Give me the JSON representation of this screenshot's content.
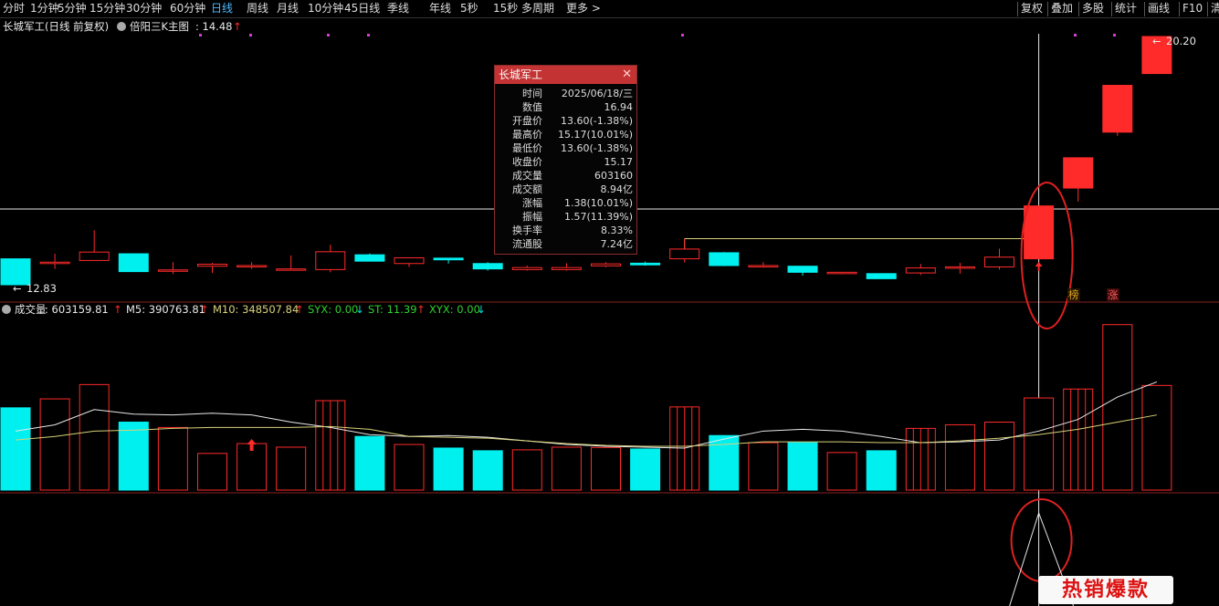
{
  "toolbar": {
    "periods": [
      "分时",
      "1分钟",
      "5分钟",
      "15分钟",
      "30分钟",
      "60分钟",
      "日线",
      "周线",
      "月线",
      "10分钟",
      "45日线",
      "季线",
      "年线",
      "5秒",
      "15秒",
      "多周期",
      "更多 >"
    ],
    "active_period": "日线",
    "right_buttons": [
      "复权",
      "叠加",
      "多股",
      "统计",
      "画线",
      "F10",
      "清"
    ]
  },
  "main_panel": {
    "title": "长城军工(日线 前复权)",
    "indicator": "倍阳三K主图",
    "indicator_value": ": 14.48",
    "high_label": "20.20",
    "low_label": "12.83",
    "tags": [
      "榜",
      "涨"
    ]
  },
  "volume_panel": {
    "label": "成交量",
    "value": ": 603159.81",
    "ma5": "M5: 390763.81",
    "ma10": "M10: 348507.84",
    "syx": "SYX: 0.00",
    "st": "ST: 11.39",
    "xyx": "XYX: 0.00"
  },
  "tooltip": {
    "title": "长城军工",
    "rows": [
      {
        "key": "时间",
        "value": "2025/06/18/三",
        "color": "white"
      },
      {
        "key": "数值",
        "value": "16.94",
        "color": "white"
      },
      {
        "key": "开盘价",
        "value": "13.60(-1.38%)",
        "color": "green"
      },
      {
        "key": "最高价",
        "value": "15.17(10.01%)",
        "color": "red"
      },
      {
        "key": "最低价",
        "value": "13.60(-1.38%)",
        "color": "green"
      },
      {
        "key": "收盘价",
        "value": "15.17",
        "color": "red"
      },
      {
        "key": "成交量",
        "value": "603160",
        "color": "yellow"
      },
      {
        "key": "成交额",
        "value": "8.94亿",
        "color": "white"
      },
      {
        "key": "涨幅",
        "value": "1.38(10.01%)",
        "color": "red"
      },
      {
        "key": "振幅",
        "value": "1.57(11.39%)",
        "color": "white"
      },
      {
        "key": "换手率",
        "value": "8.33%",
        "color": "white"
      },
      {
        "key": "流通股",
        "value": "7.24亿",
        "color": "white"
      }
    ]
  },
  "badge": "热销爆款",
  "colors": {
    "up": "#ff2a2a",
    "down": "#00f0f0",
    "ma5": "#e8e8e8",
    "ma10": "#d8d27a",
    "active": "#4fb8ff",
    "annot": "#e02020"
  },
  "chart_data": {
    "type": "candlestick",
    "candles": [
      {
        "o": 13.6,
        "c": 12.83,
        "h": 13.6,
        "l": 12.83
      },
      {
        "o": 13.5,
        "c": 13.5,
        "h": 13.75,
        "l": 13.3
      },
      {
        "o": 13.55,
        "c": 13.8,
        "h": 14.45,
        "l": 13.55
      },
      {
        "o": 13.75,
        "c": 13.22,
        "h": 13.75,
        "l": 13.22
      },
      {
        "o": 13.23,
        "c": 13.27,
        "h": 13.5,
        "l": 13.15
      },
      {
        "o": 13.38,
        "c": 13.44,
        "h": 13.48,
        "l": 13.18
      },
      {
        "o": 13.4,
        "c": 13.4,
        "h": 13.5,
        "l": 13.3
      },
      {
        "o": 13.26,
        "c": 13.3,
        "h": 13.7,
        "l": 13.26
      },
      {
        "o": 13.28,
        "c": 13.81,
        "h": 14.02,
        "l": 13.2
      },
      {
        "o": 13.72,
        "c": 13.53,
        "h": 13.76,
        "l": 13.53
      },
      {
        "o": 13.46,
        "c": 13.63,
        "h": 13.63,
        "l": 13.36
      },
      {
        "o": 13.62,
        "c": 13.57,
        "h": 13.62,
        "l": 13.46
      },
      {
        "o": 13.46,
        "c": 13.3,
        "h": 13.5,
        "l": 13.25
      },
      {
        "o": 13.28,
        "c": 13.34,
        "h": 13.4,
        "l": 13.25
      },
      {
        "o": 13.28,
        "c": 13.34,
        "h": 13.47,
        "l": 13.25
      },
      {
        "o": 13.39,
        "c": 13.45,
        "h": 13.5,
        "l": 13.35
      },
      {
        "o": 13.47,
        "c": 13.42,
        "h": 13.52,
        "l": 13.39
      },
      {
        "o": 13.6,
        "c": 13.89,
        "h": 14.2,
        "l": 13.49
      },
      {
        "o": 13.78,
        "c": 13.4,
        "h": 13.8,
        "l": 13.38
      },
      {
        "o": 13.36,
        "c": 13.4,
        "h": 13.5,
        "l": 13.34
      },
      {
        "o": 13.38,
        "c": 13.2,
        "h": 13.38,
        "l": 13.1
      },
      {
        "o": 13.2,
        "c": 13.2,
        "h": 13.2,
        "l": 13.14
      },
      {
        "o": 13.16,
        "c": 13.01,
        "h": 13.16,
        "l": 13.01
      },
      {
        "o": 13.18,
        "c": 13.33,
        "h": 13.45,
        "l": 13.12
      },
      {
        "o": 13.36,
        "c": 13.36,
        "h": 13.48,
        "l": 13.16
      },
      {
        "o": 13.36,
        "c": 13.65,
        "h": 13.9,
        "l": 13.28
      },
      {
        "o": 13.6,
        "c": 15.17,
        "h": 15.17,
        "l": 13.6
      },
      {
        "o": 15.7,
        "c": 16.6,
        "h": 16.6,
        "l": 15.3
      },
      {
        "o": 17.36,
        "c": 18.75,
        "h": 18.75,
        "l": 17.25
      },
      {
        "o": 19.1,
        "c": 20.2,
        "h": 20.2,
        "l": 19.1
      }
    ],
    "volume": [
      460,
      510,
      590,
      380,
      350,
      205,
      260,
      240,
      500,
      300,
      255,
      235,
      220,
      225,
      240,
      238,
      230,
      465,
      305,
      265,
      265,
      210,
      220,
      345,
      365,
      380,
      515,
      565,
      925,
      585
    ],
    "ma5_series": [
      330,
      365,
      450,
      425,
      420,
      430,
      420,
      380,
      350,
      310,
      300,
      305,
      295,
      275,
      255,
      245,
      240,
      235,
      285,
      330,
      340,
      330,
      300,
      265,
      270,
      280,
      330,
      395,
      520,
      605
    ],
    "ma10_series": [
      280,
      300,
      330,
      335,
      345,
      350,
      350,
      350,
      355,
      340,
      300,
      295,
      290,
      275,
      260,
      250,
      245,
      245,
      255,
      270,
      270,
      270,
      265,
      265,
      275,
      290,
      310,
      340,
      380,
      420
    ],
    "selected_date": "2025/06/18/三"
  }
}
